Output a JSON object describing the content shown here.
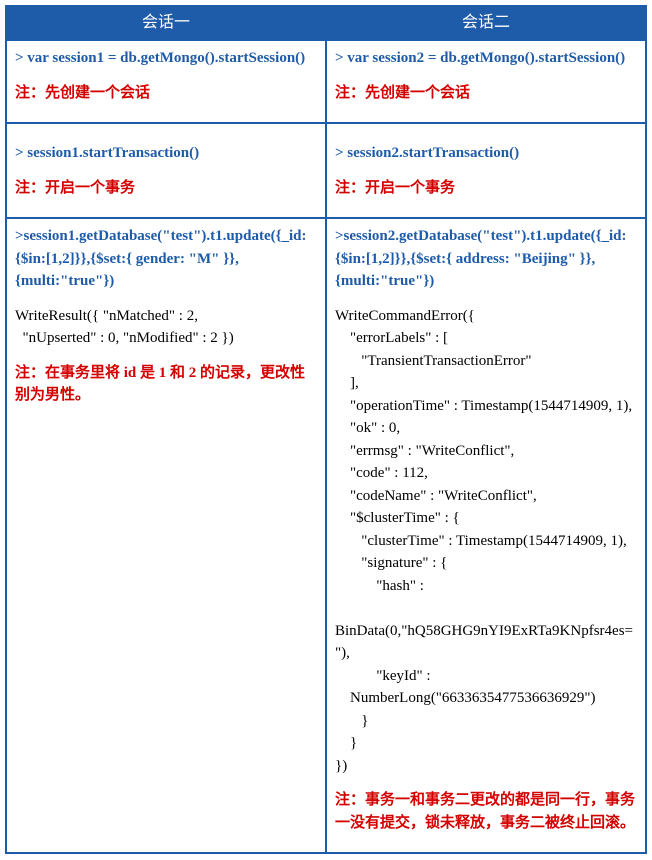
{
  "headers": {
    "col1": "会话一",
    "col2": "会话二"
  },
  "row1": {
    "col1": {
      "cmd": "> var session1 = db.getMongo().startSession()",
      "note": "注：先创建一个会话"
    },
    "col2": {
      "cmd": "> var session2 = db.getMongo().startSession()",
      "note": "注：先创建一个会话"
    }
  },
  "row2": {
    "col1": {
      "cmd": "> session1.startTransaction()",
      "note": "注：开启一个事务"
    },
    "col2": {
      "cmd": "> session2.startTransaction()",
      "note": "注：开启一个事务"
    }
  },
  "row3": {
    "col1": {
      "cmd": ">session1.getDatabase(\"test\").t1.update({_id:{$in:[1,2]}},{$set:{ gender: \"M\" }},{multi:\"true\"})",
      "out": "WriteResult({ \"nMatched\" : 2,\n  \"nUpserted\" : 0, \"nModified\" : 2 })",
      "note": "注：在事务里将 id 是 1 和 2 的记录，更改性别为男性。"
    },
    "col2": {
      "cmd": ">session2.getDatabase(\"test\").t1.update({_id:{$in:[1,2]}},{$set:{ address: \"Beijing\" }},{multi:\"true\"})",
      "out": "WriteCommandError({\n    \"errorLabels\" : [\n       \"TransientTransactionError\"\n    ],\n    \"operationTime\" : Timestamp(1544714909, 1),\n    \"ok\" : 0,\n    \"errmsg\" : \"WriteConflict\",\n    \"code\" : 112,\n    \"codeName\" : \"WriteConflict\",\n    \"$clusterTime\" : {\n       \"clusterTime\" : Timestamp(1544714909, 1),\n       \"signature\" : {\n           \"hash\" :\n    BinData(0,\"hQ58GHG9nYI9ExRTa9KNpfsr4es=\"),\n           \"keyId\" :\n    NumberLong(\"6633635477536636929\")\n       }\n    }\n})",
      "note": "注：事务一和事务二更改的都是同一行，事务一没有提交，锁未释放，事务二被终止回滚。"
    }
  }
}
